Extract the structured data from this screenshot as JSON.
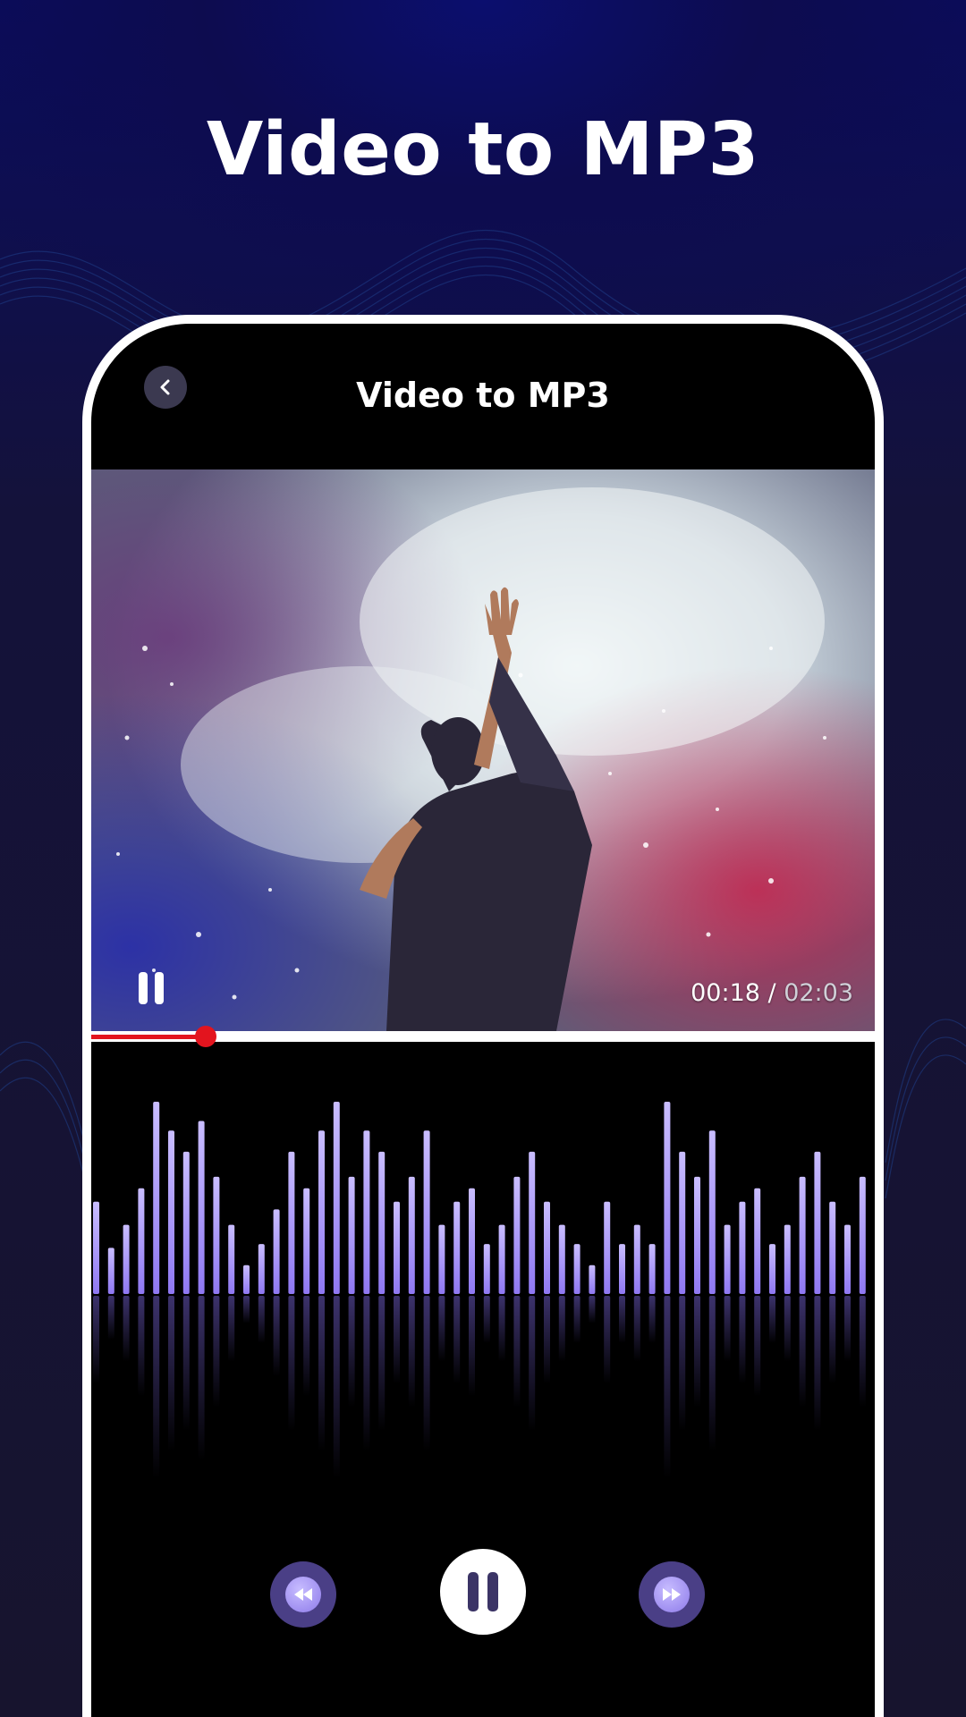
{
  "headline": "Video to MP3",
  "app": {
    "title": "Video to MP3",
    "back_icon": "chevron-left-icon"
  },
  "player": {
    "current_time": "00:18",
    "separator": " / ",
    "total_time": "02:03",
    "progress": 0.146
  },
  "colors": {
    "accent": "#9a86ff",
    "progress": "#e3141e",
    "control_bg": "#4a3f86"
  },
  "waveform": {
    "levels": [
      0.48,
      0.24,
      0.36,
      0.55,
      1.0,
      0.85,
      0.74,
      0.9,
      0.61,
      0.36,
      0.15,
      0.26,
      0.44,
      0.74,
      0.55,
      0.85,
      1.0,
      0.61,
      0.85,
      0.74,
      0.48,
      0.61,
      0.85,
      0.36,
      0.48,
      0.55,
      0.26,
      0.36,
      0.61,
      0.74,
      0.48,
      0.36,
      0.26,
      0.15,
      0.48,
      0.26,
      0.36,
      0.26,
      1.0,
      0.74,
      0.61,
      0.85,
      0.36,
      0.48,
      0.55,
      0.26,
      0.36,
      0.61,
      0.74,
      0.48,
      0.36,
      0.61
    ]
  },
  "controls": {
    "rewind_icon": "rewind-icon",
    "play_pause_icon": "pause-icon",
    "forward_icon": "fast-forward-icon"
  }
}
